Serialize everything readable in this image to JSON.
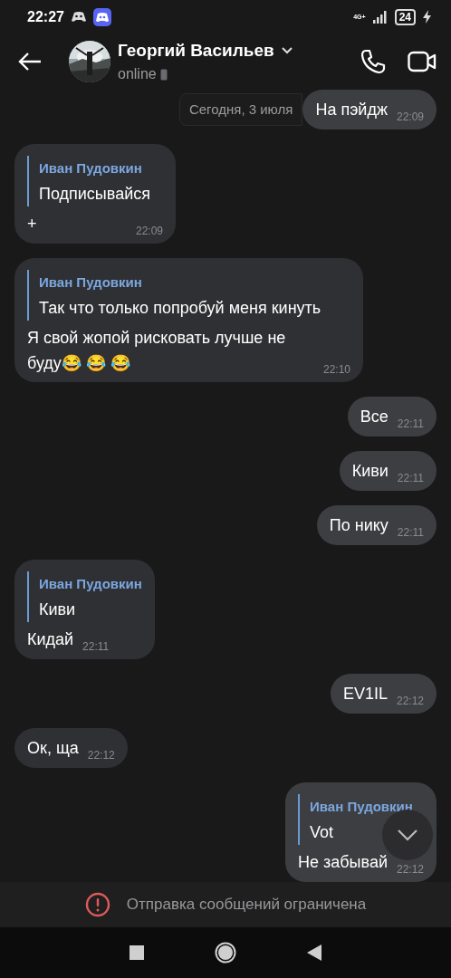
{
  "status_bar": {
    "time": "22:27",
    "network": "4G+",
    "battery": "24",
    "charging": true
  },
  "header": {
    "name": "Георгий Васильев",
    "presence": "online"
  },
  "date_chip": "Сегодня, 3 июля",
  "messages": [
    {
      "outgoing": true,
      "text": "На пэйдж",
      "time": "22:09"
    },
    {
      "outgoing": false,
      "reply": {
        "author": "Иван Пудовкин",
        "text": "Подписывайся"
      },
      "text": "+",
      "time": "22:09"
    },
    {
      "outgoing": false,
      "reply": {
        "author": "Иван Пудовкин",
        "text": "Так что только попробуй меня кинуть"
      },
      "text": "Я свой жопой рисковать лучше не буду😂 😂 😂",
      "time": "22:10"
    },
    {
      "outgoing": true,
      "text": "Все",
      "time": "22:11"
    },
    {
      "outgoing": true,
      "text": "Киви",
      "time": "22:11"
    },
    {
      "outgoing": true,
      "text": "По нику",
      "time": "22:11"
    },
    {
      "outgoing": false,
      "reply": {
        "author": "Иван Пудовкин",
        "text": "Киви"
      },
      "text": "Кидай",
      "time": "22:11"
    },
    {
      "outgoing": true,
      "text": "EV1IL",
      "time": "22:12"
    },
    {
      "outgoing": false,
      "text": "Ок, ща",
      "time": "22:12"
    },
    {
      "outgoing": true,
      "reply": {
        "author": "Иван Пудовкин",
        "text": "Vot"
      },
      "text": "Не забывай",
      "time": "22:12"
    }
  ],
  "restriction": "Отправка сообщений ограничена"
}
